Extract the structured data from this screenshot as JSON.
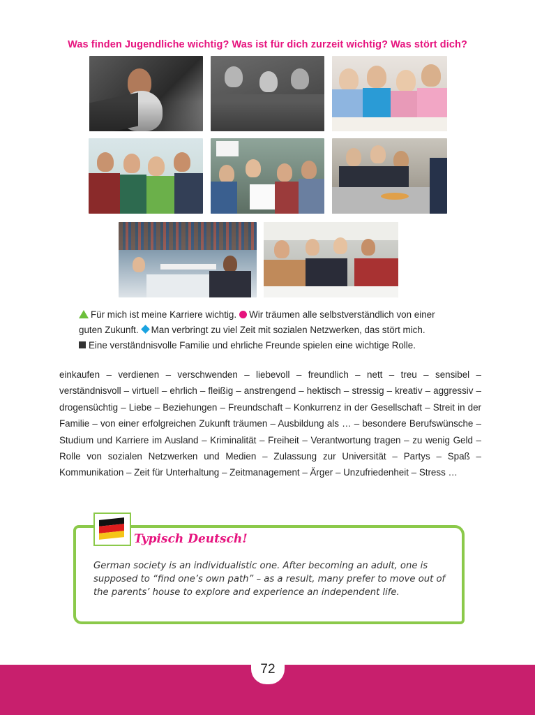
{
  "heading": "Was finden Jugendliche wichtig? Was ist für dich zurzeit wichtig? Was stört dich?",
  "bullets": {
    "line1_a": "Für mich ist meine Karriere wichtig.",
    "line1_b": "Wir träumen alle selbstverständlich von einer",
    "line2_a": "guten Zukunft.",
    "line2_b": "Man verbringt zu viel Zeit mit sozialen Netzwerken, das stört mich.",
    "line3": "Eine verständnisvolle Familie und ehrliche Freunde spielen eine wichtige Rolle."
  },
  "wordlist": "einkaufen – verdienen – verschwenden – liebevoll – freundlich – nett – treu – sensibel – verständnisvoll – virtuell – ehrlich – fleißig – anstrengend – hektisch – stressig – kreativ – aggressiv – drogensüchtig – Liebe – Beziehungen – Freundschaft – Konkurrenz in der Gesellschaft – Streit in der Familie – von einer erfolgreichen Zukunft träumen – Ausbildung als … – besondere Berufswünsche – Studium und Karriere im Ausland – Kriminalität – Freiheit – Verantwortung tragen – zu wenig Geld – Rolle von sozialen Netzwerken und Medien – Zulassung zur Universität – Partys – Spaß – Kommunikation – Zeit für Unterhaltung – Zeitmanagement – Ärger – Unzufriedenheit – Stress …",
  "infobox": {
    "title": "Typisch Deutsch!",
    "text": "German society is an individualistic one. After becoming an adult, one is supposed to “find one’s own path” – as a result, many prefer to move out of the parents’ house to explore and experience an independent life."
  },
  "page_number": "72",
  "colors": {
    "accent_pink": "#e6137e",
    "accent_green": "#8bc94a",
    "footer": "#c81f6d",
    "triangle": "#6cbf3b",
    "diamond": "#1aa3e0"
  }
}
